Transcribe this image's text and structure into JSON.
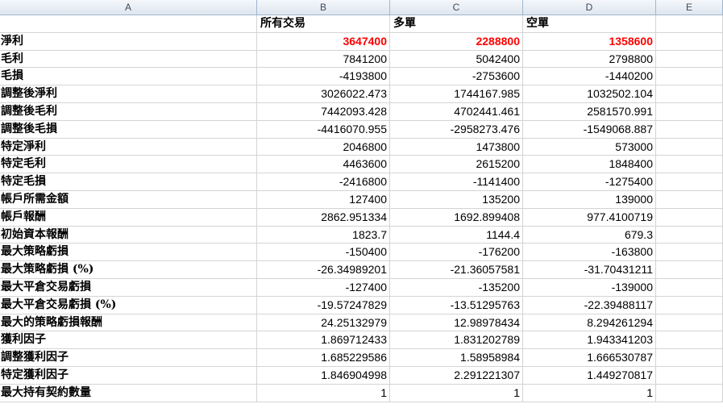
{
  "columns": [
    "A",
    "B",
    "C",
    "D",
    "E"
  ],
  "header_row": {
    "a": "",
    "b": "所有交易",
    "c": "多單",
    "d": "空單"
  },
  "accent_color": "#ff0000",
  "rows": [
    {
      "label": "淨利",
      "b": "3647400",
      "c": "2288800",
      "d": "1358600",
      "highlight": true
    },
    {
      "label": "毛利",
      "b": "7841200",
      "c": "5042400",
      "d": "2798800"
    },
    {
      "label": "毛損",
      "b": "-4193800",
      "c": "-2753600",
      "d": "-1440200"
    },
    {
      "label": "調整後淨利",
      "b": "3026022.473",
      "c": "1744167.985",
      "d": "1032502.104"
    },
    {
      "label": "調整後毛利",
      "b": "7442093.428",
      "c": "4702441.461",
      "d": "2581570.991"
    },
    {
      "label": "調整後毛損",
      "b": "-4416070.955",
      "c": "-2958273.476",
      "d": "-1549068.887"
    },
    {
      "label": "特定淨利",
      "b": "2046800",
      "c": "1473800",
      "d": "573000"
    },
    {
      "label": "特定毛利",
      "b": "4463600",
      "c": "2615200",
      "d": "1848400"
    },
    {
      "label": "特定毛損",
      "b": "-2416800",
      "c": "-1141400",
      "d": "-1275400"
    },
    {
      "label": "帳戶所需金額",
      "b": "127400",
      "c": "135200",
      "d": "139000"
    },
    {
      "label": "帳戶報酬",
      "b": "2862.951334",
      "c": "1692.899408",
      "d": "977.4100719"
    },
    {
      "label": "初始資本報酬",
      "b": "1823.7",
      "c": "1144.4",
      "d": "679.3"
    },
    {
      "label": "最大策略虧損",
      "b": "-150400",
      "c": "-176200",
      "d": "-163800"
    },
    {
      "label": "最大策略虧損 (%)",
      "b": "-26.34989201",
      "c": "-21.36057581",
      "d": "-31.70431211"
    },
    {
      "label": "最大平倉交易虧損",
      "b": "-127400",
      "c": "-135200",
      "d": "-139000"
    },
    {
      "label": "最大平倉交易虧損 (%)",
      "b": "-19.57247829",
      "c": "-13.51295763",
      "d": "-22.39488117"
    },
    {
      "label": "最大的策略虧損報酬",
      "b": "24.25132979",
      "c": "12.98978434",
      "d": "8.294261294"
    },
    {
      "label": "獲利因子",
      "b": "1.869712433",
      "c": "1.831202789",
      "d": "1.943341203"
    },
    {
      "label": "調整獲利因子",
      "b": "1.685229586",
      "c": "1.58958984",
      "d": "1.666530787"
    },
    {
      "label": "特定獲利因子",
      "b": "1.846904998",
      "c": "2.291221307",
      "d": "1.449270817"
    },
    {
      "label": "最大持有契約數量",
      "b": "1",
      "c": "1",
      "d": "1"
    }
  ]
}
